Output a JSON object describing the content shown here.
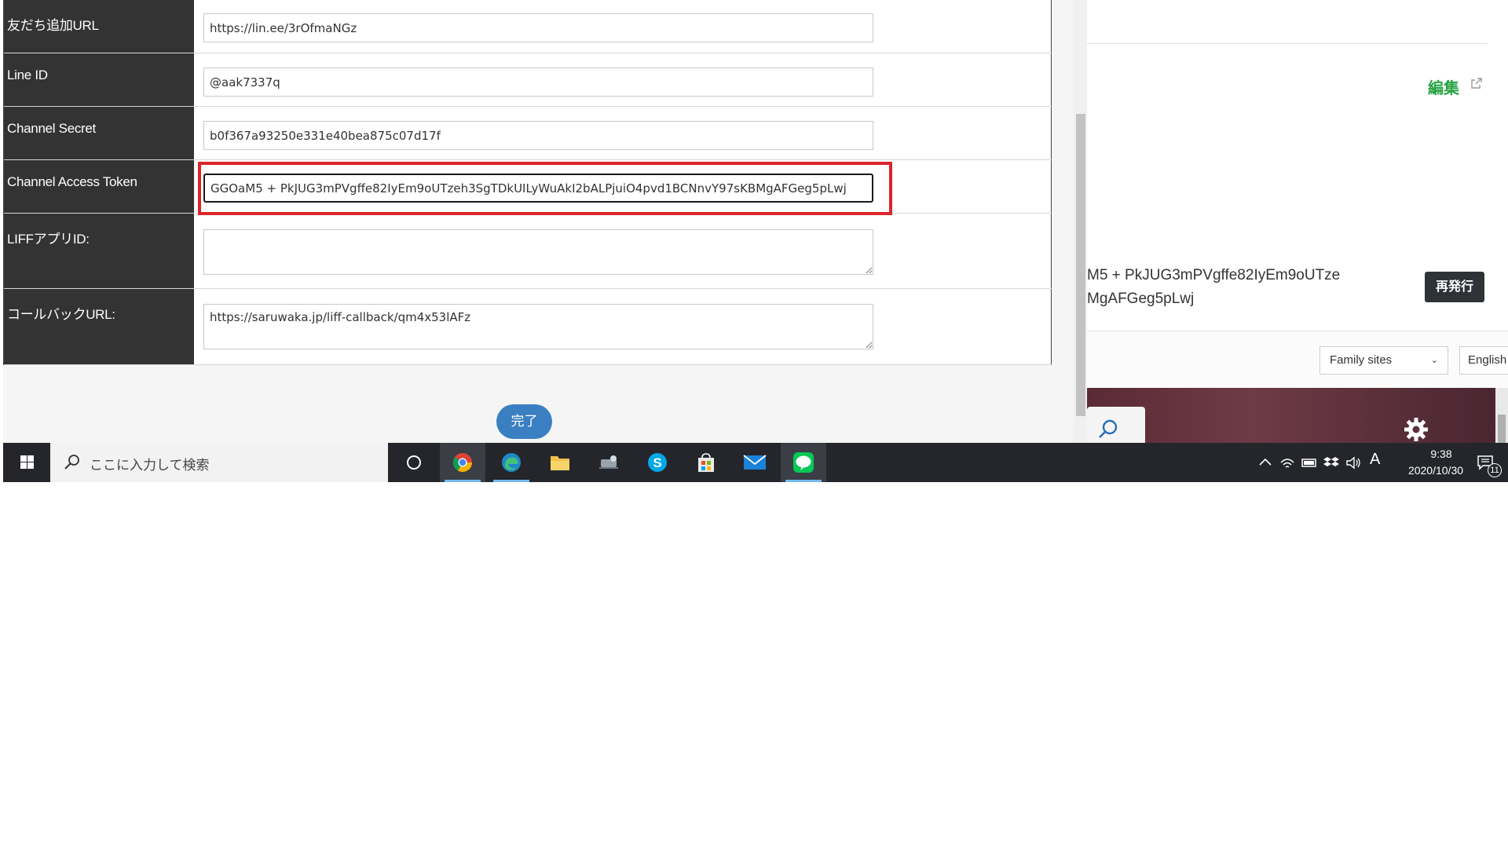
{
  "form": {
    "rows": [
      {
        "label": "友だち追加URL",
        "value": "https://lin.ee/3rOfmaNGz"
      },
      {
        "label": "Line ID",
        "value": "@aak7337q"
      },
      {
        "label": "Channel Secret",
        "value": "b0f367a93250e331e40bea875c07d17f"
      },
      {
        "label": "Channel Access Token",
        "value": "GGOaM5 + PkJUG3mPVgffe82IyEm9oUTzeh3SgTDkUILyWuAkI2bALPjuiO4pvd1BCNnvY97sKBMgAFGeg5pLwj"
      },
      {
        "label": "LIFFアプリID:",
        "value": ""
      },
      {
        "label": "コールバックURL:",
        "value": "https://saruwaka.jp/liff-callback/qm4x53lAFz"
      }
    ],
    "highlight_color": "#d9252b",
    "done_button": "完了"
  },
  "console": {
    "edit_link": "編集",
    "token_line_1": "M5 + PkJUG3mPVgffe82IyEm9oUTze",
    "token_line_2": "MgAFGeg5pLwj",
    "reissue_button": "再発行",
    "family_sites": "Family sites",
    "language": "English",
    "accent_color": "#27a444"
  },
  "taskbar": {
    "search_placeholder": "ここに入力して検索",
    "apps": [
      "cortana-icon",
      "chrome-icon",
      "edge-icon",
      "file-explorer-icon",
      "network-tool-icon",
      "skype-icon",
      "store-icon",
      "mail-icon",
      "line-icon"
    ],
    "time": "9:38",
    "date": "2020/10/30",
    "ime_indicator": "A",
    "notification_count": "11"
  }
}
